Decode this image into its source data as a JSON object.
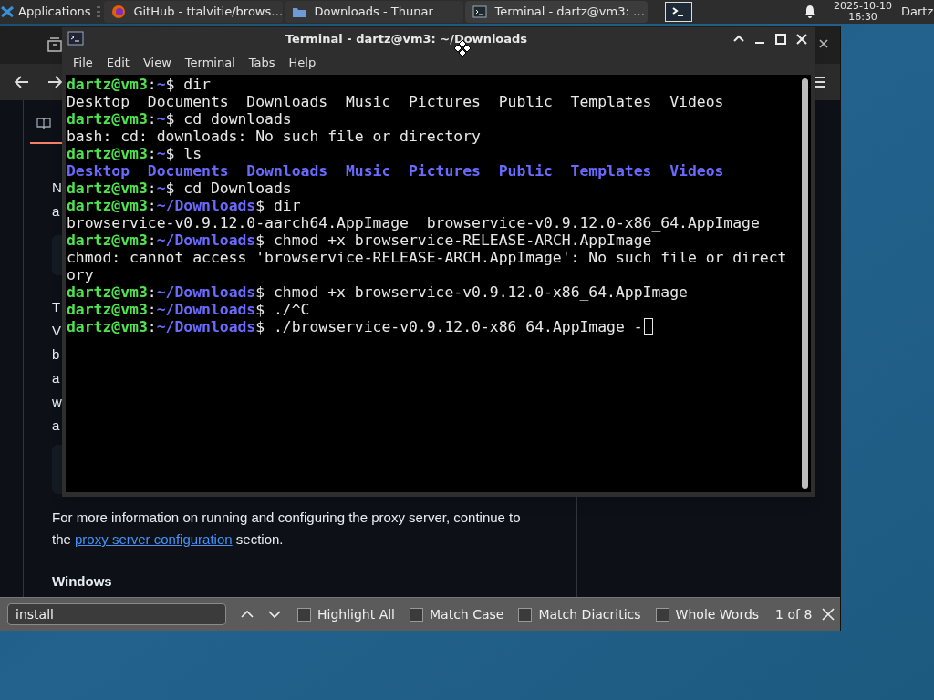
{
  "taskbar": {
    "menu_label": "Applications",
    "tasks": [
      {
        "label": "GitHub - ttalvitie/brows…",
        "kind": "browser",
        "selected": false
      },
      {
        "label": "Downloads - Thunar",
        "kind": "folder",
        "selected": false
      },
      {
        "label": "Terminal - dartz@vm3: …",
        "kind": "terminal",
        "selected": true
      }
    ],
    "clock_date": "2025-10-10",
    "clock_time": "16:30",
    "user": "Dartz"
  },
  "browser": {
    "visible_fragments": [
      "N",
      "a",
      "T",
      "V",
      "b",
      "a",
      "w",
      "a"
    ],
    "paragraph": "For more information on running and configuring the proxy server, continue to the ",
    "link": "proxy server configuration",
    "paragraph_end": " section.",
    "heading": "Windows",
    "find_bar": {
      "value": "install",
      "options": [
        {
          "label": "Highlight All",
          "checked": false
        },
        {
          "label": "Match Case",
          "checked": false
        },
        {
          "label": "Match Diacritics",
          "checked": false
        },
        {
          "label": "Whole Words",
          "checked": false
        }
      ],
      "result": "1 of 8"
    }
  },
  "terminal": {
    "title": "Terminal - dartz@vm3: ~/Downloads",
    "menu": [
      "File",
      "Edit",
      "View",
      "Terminal",
      "Tabs",
      "Help"
    ],
    "lines": [
      [
        {
          "kind": "user",
          "text": "dartz@vm3"
        },
        {
          "kind": "plain",
          "text": ":"
        },
        {
          "kind": "path",
          "text": "~"
        },
        {
          "kind": "plain",
          "text": "$ dir"
        }
      ],
      [
        {
          "kind": "plain",
          "text": "Desktop  Documents  Downloads  Music  Pictures  Public  Templates  Videos"
        }
      ],
      [
        {
          "kind": "user",
          "text": "dartz@vm3"
        },
        {
          "kind": "plain",
          "text": ":"
        },
        {
          "kind": "path",
          "text": "~"
        },
        {
          "kind": "plain",
          "text": "$ cd downloads"
        }
      ],
      [
        {
          "kind": "plain",
          "text": "bash: cd: downloads: No such file or directory"
        }
      ],
      [
        {
          "kind": "user",
          "text": "dartz@vm3"
        },
        {
          "kind": "plain",
          "text": ":"
        },
        {
          "kind": "path",
          "text": "~"
        },
        {
          "kind": "plain",
          "text": "$ ls"
        }
      ],
      [
        {
          "kind": "dir",
          "text": "Desktop  Documents  Downloads  Music  Pictures  Public  Templates  Videos"
        }
      ],
      [
        {
          "kind": "user",
          "text": "dartz@vm3"
        },
        {
          "kind": "plain",
          "text": ":"
        },
        {
          "kind": "path",
          "text": "~"
        },
        {
          "kind": "plain",
          "text": "$ cd Downloads"
        }
      ],
      [
        {
          "kind": "user",
          "text": "dartz@vm3"
        },
        {
          "kind": "plain",
          "text": ":"
        },
        {
          "kind": "path",
          "text": "~/Downloads"
        },
        {
          "kind": "plain",
          "text": "$ dir"
        }
      ],
      [
        {
          "kind": "plain",
          "text": "browservice-v0.9.12.0-aarch64.AppImage  browservice-v0.9.12.0-x86_64.AppImage"
        }
      ],
      [
        {
          "kind": "user",
          "text": "dartz@vm3"
        },
        {
          "kind": "plain",
          "text": ":"
        },
        {
          "kind": "path",
          "text": "~/Downloads"
        },
        {
          "kind": "plain",
          "text": "$ chmod +x browservice-RELEASE-ARCH.AppImage"
        }
      ],
      [
        {
          "kind": "plain",
          "text": "chmod: cannot access 'browservice-RELEASE-ARCH.AppImage': No such file or direct"
        }
      ],
      [
        {
          "kind": "plain",
          "text": "ory"
        }
      ],
      [
        {
          "kind": "user",
          "text": "dartz@vm3"
        },
        {
          "kind": "plain",
          "text": ":"
        },
        {
          "kind": "path",
          "text": "~/Downloads"
        },
        {
          "kind": "plain",
          "text": "$ chmod +x browservice-v0.9.12.0-x86_64.AppImage"
        }
      ],
      [
        {
          "kind": "user",
          "text": "dartz@vm3"
        },
        {
          "kind": "plain",
          "text": ":"
        },
        {
          "kind": "path",
          "text": "~/Downloads"
        },
        {
          "kind": "plain",
          "text": "$ ./^C"
        }
      ],
      [
        {
          "kind": "user",
          "text": "dartz@vm3"
        },
        {
          "kind": "plain",
          "text": ":"
        },
        {
          "kind": "path",
          "text": "~/Downloads"
        },
        {
          "kind": "plain",
          "text": "$ ./browservice-v0.9.12.0-x86_64.AppImage -"
        },
        {
          "kind": "cursor"
        }
      ]
    ]
  }
}
